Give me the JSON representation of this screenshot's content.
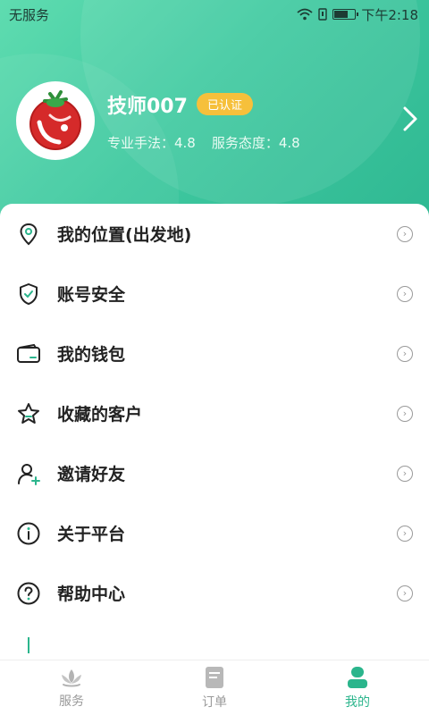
{
  "status_bar": {
    "carrier": "无服务",
    "time": "下午2:18"
  },
  "profile": {
    "name": "技师007",
    "badge": "已认证",
    "skill_rating": "专业手法：4.8",
    "service_rating": "服务态度：4.8"
  },
  "menu": {
    "items": [
      {
        "label": "我的位置(出发地)",
        "icon": "location-pin-icon"
      },
      {
        "label": "账号安全",
        "icon": "shield-check-icon"
      },
      {
        "label": "我的钱包",
        "icon": "wallet-icon"
      },
      {
        "label": "收藏的客户",
        "icon": "star-icon"
      },
      {
        "label": "邀请好友",
        "icon": "add-user-icon"
      },
      {
        "label": "关于平台",
        "icon": "info-icon"
      },
      {
        "label": "帮助中心",
        "icon": "help-icon"
      }
    ]
  },
  "tabbar": {
    "tabs": [
      {
        "label": "服务",
        "icon": "lotus-icon",
        "active": false
      },
      {
        "label": "订单",
        "icon": "document-icon",
        "active": false
      },
      {
        "label": "我的",
        "icon": "user-icon",
        "active": true
      }
    ]
  },
  "colors": {
    "accent": "#2bb58c",
    "header_start": "#5fdcb0",
    "header_end": "#2fb892",
    "badge": "#f6c03b"
  }
}
